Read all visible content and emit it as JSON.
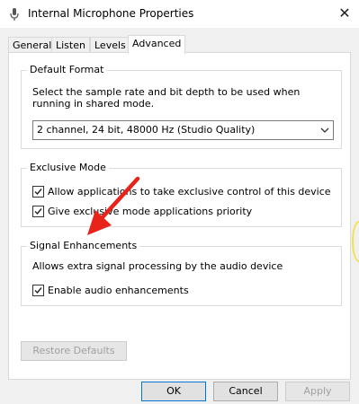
{
  "window": {
    "title": "Internal Microphone Properties",
    "close_glyph": "✕",
    "icon": "microphone-icon"
  },
  "tabs": [
    {
      "label": "General",
      "active": false
    },
    {
      "label": "Listen",
      "active": false
    },
    {
      "label": "Levels",
      "active": false
    },
    {
      "label": "Advanced",
      "active": true
    }
  ],
  "default_format": {
    "title": "Default Format",
    "description": "Select the sample rate and bit depth to be used when running in shared mode.",
    "selected": "2 channel, 24 bit, 48000 Hz (Studio Quality)"
  },
  "exclusive_mode": {
    "title": "Exclusive Mode",
    "options": [
      {
        "label": "Allow applications to take exclusive control of this device",
        "checked": true
      },
      {
        "label": "Give exclusive mode applications priority",
        "checked": true
      }
    ]
  },
  "signal_enhancements": {
    "title": "Signal Enhancements",
    "description": "Allows extra signal processing by the audio device",
    "option": {
      "label": "Enable audio enhancements",
      "checked": true
    }
  },
  "buttons": {
    "restore_defaults": "Restore Defaults",
    "ok": "OK",
    "cancel": "Cancel",
    "apply": "Apply"
  },
  "annotation": {
    "arrow_color": "#e8231c"
  }
}
